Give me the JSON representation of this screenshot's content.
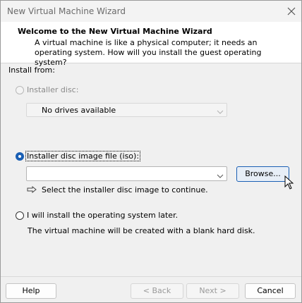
{
  "window": {
    "title": "New Virtual Machine Wizard"
  },
  "header": {
    "title": "Welcome to the New Virtual Machine Wizard",
    "description": "A virtual machine is like a physical computer; it needs an operating system. How will you install the guest operating system?"
  },
  "install_from": {
    "label": "Install from:",
    "installer_disc": {
      "label": "Installer disc:",
      "selected": false,
      "disabled": true,
      "drive_value": "No drives available"
    },
    "iso": {
      "label": "Installer disc image file (iso):",
      "selected": true,
      "value": "",
      "browse_label": "Browse...",
      "hint": "Select the installer disc image to continue."
    },
    "later": {
      "label": "I will install the operating system later.",
      "selected": false,
      "note": "The virtual machine will be created with a blank hard disk."
    }
  },
  "footer": {
    "help": "Help",
    "back": "< Back",
    "next": "Next >",
    "cancel": "Cancel"
  }
}
